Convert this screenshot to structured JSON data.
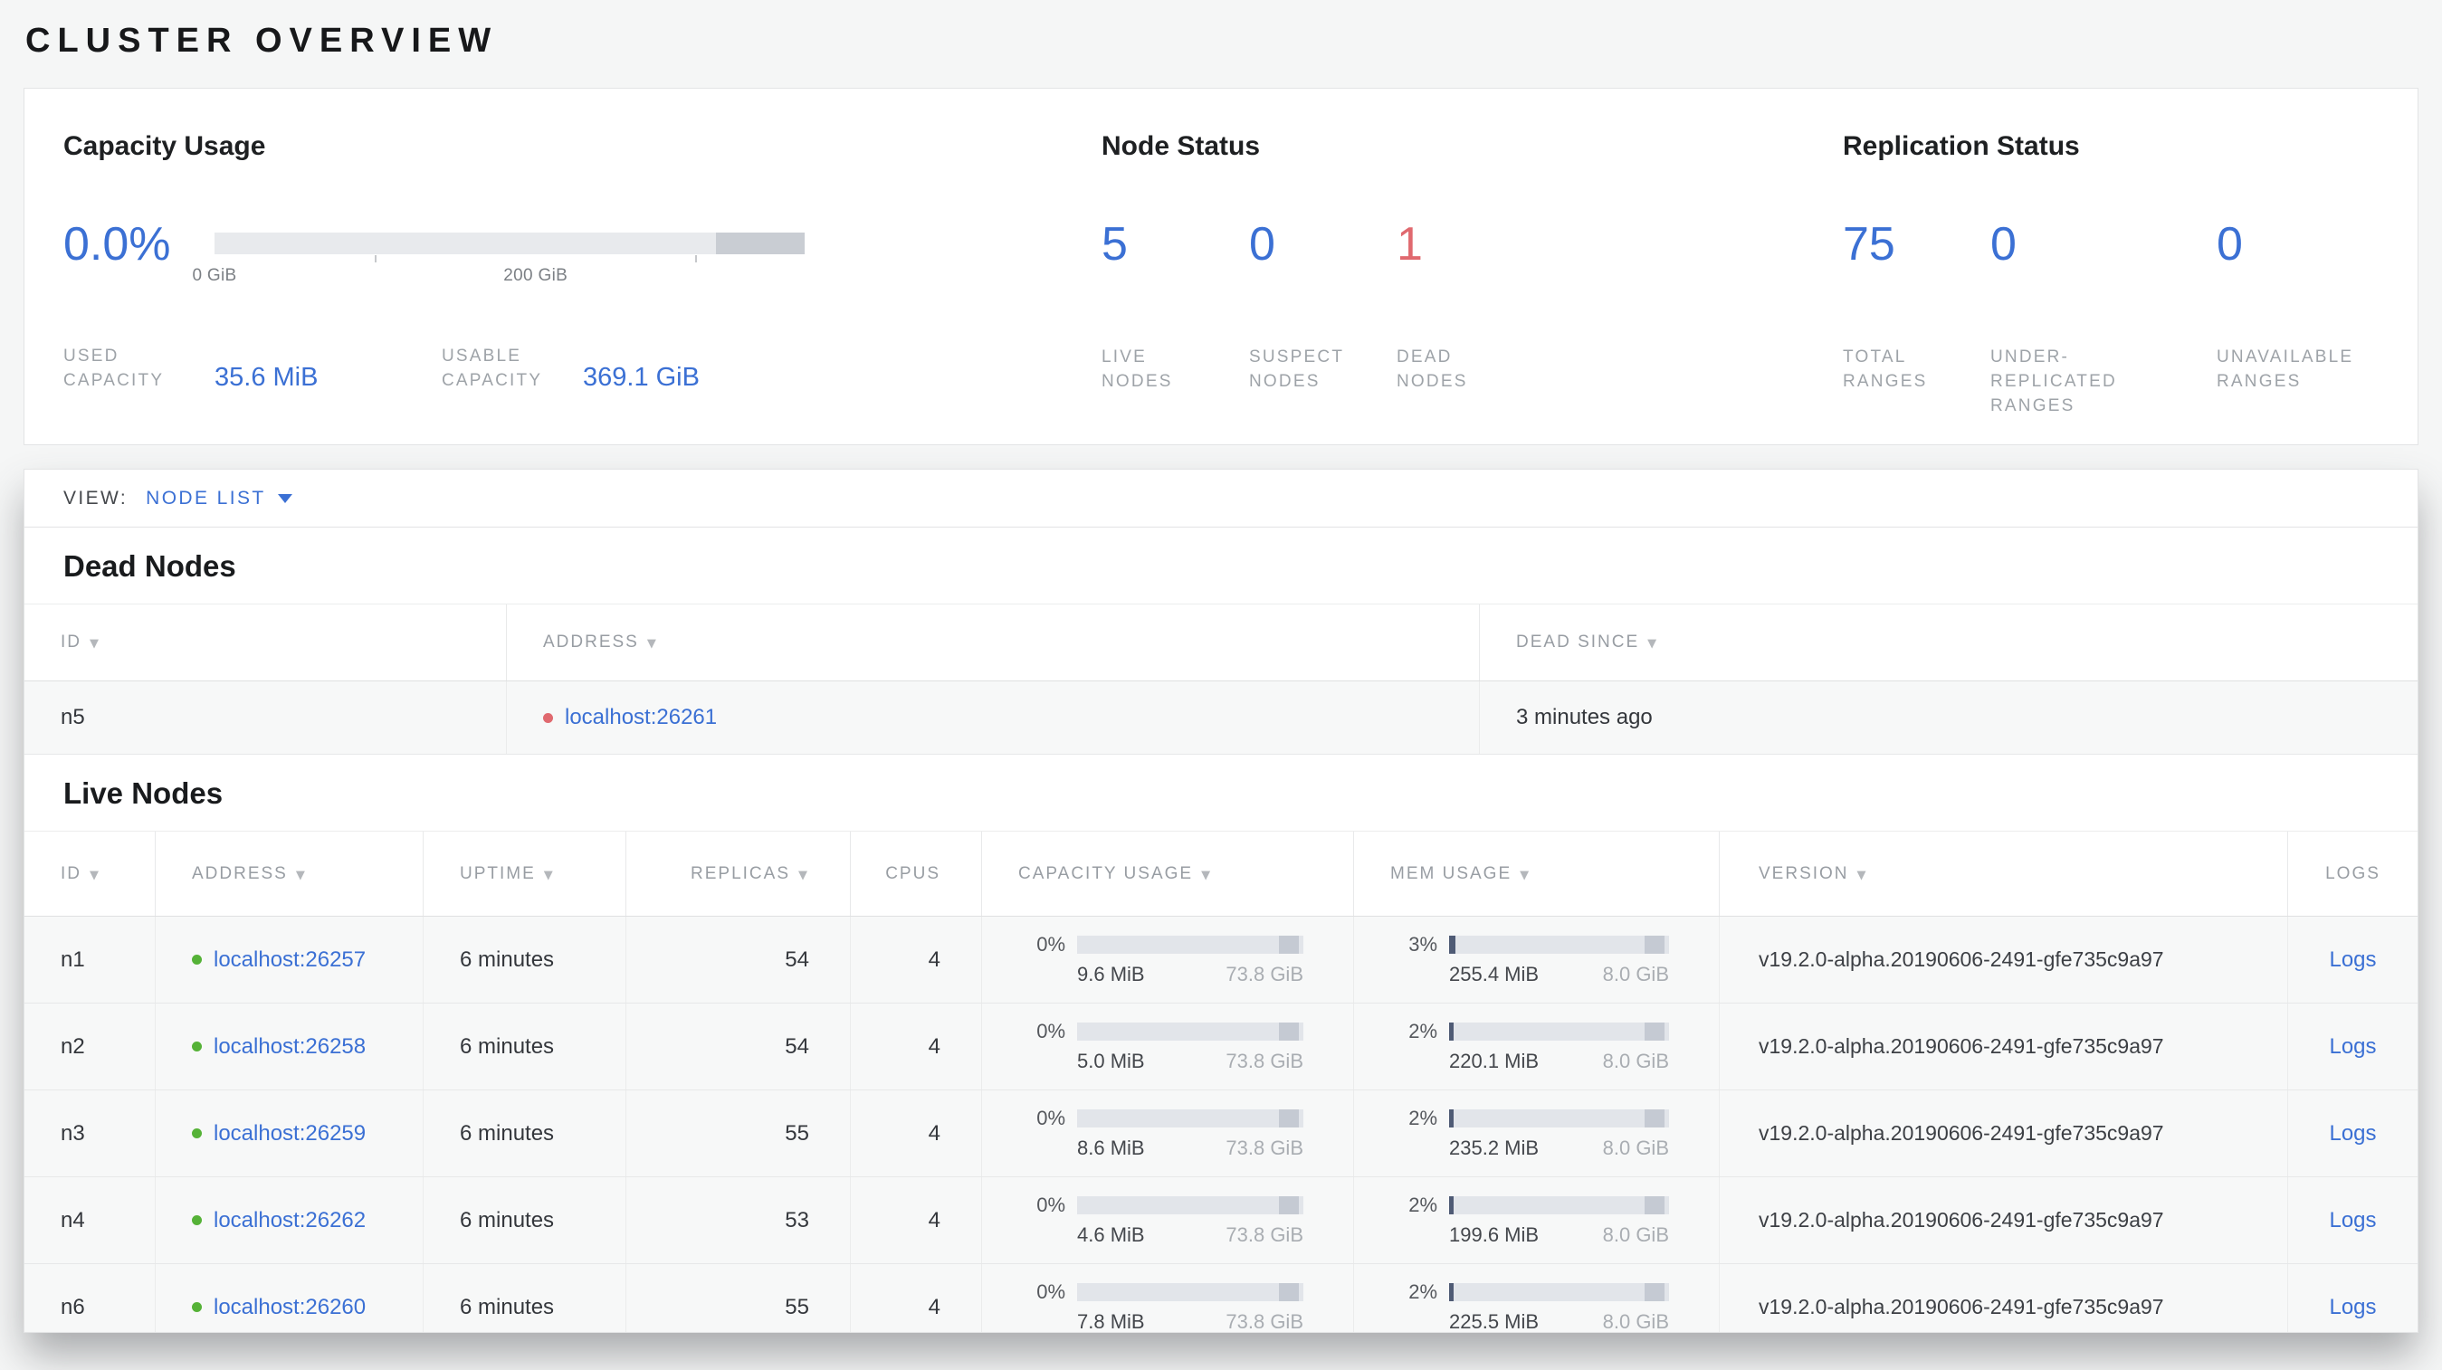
{
  "accent": {
    "blue": "#3b70d4",
    "red": "#e0696f",
    "green": "#55b237"
  },
  "page": {
    "title": "CLUSTER OVERVIEW"
  },
  "summary": {
    "capacity": {
      "title": "Capacity Usage",
      "percent": "0.0%",
      "axis_start": "0 GiB",
      "axis_mid": "200 GiB",
      "used": {
        "label": "USED CAPACITY",
        "value": "35.6 MiB"
      },
      "usable": {
        "label": "USABLE CAPACITY",
        "value": "369.1 GiB"
      }
    },
    "nodes": {
      "title": "Node Status",
      "stats": [
        {
          "value": "5",
          "label": "LIVE NODES"
        },
        {
          "value": "0",
          "label": "SUSPECT NODES"
        },
        {
          "value": "1",
          "label": "DEAD NODES"
        }
      ]
    },
    "replication": {
      "title": "Replication Status",
      "stats": [
        {
          "value": "75",
          "label": "TOTAL RANGES"
        },
        {
          "value": "0",
          "label": "UNDER-REPLICATED RANGES"
        },
        {
          "value": "0",
          "label": "UNAVAILABLE RANGES"
        }
      ]
    }
  },
  "view_bar": {
    "label": "VIEW:",
    "selected": "NODE LIST"
  },
  "dead_nodes": {
    "title": "Dead Nodes",
    "columns": [
      "ID",
      "ADDRESS",
      "DEAD SINCE"
    ],
    "rows": [
      {
        "id": "n5",
        "address": "localhost:26261",
        "dead_since": "3 minutes ago"
      }
    ]
  },
  "live_nodes": {
    "title": "Live Nodes",
    "columns": [
      "ID",
      "ADDRESS",
      "UPTIME",
      "REPLICAS",
      "CPUS",
      "CAPACITY USAGE",
      "MEM USAGE",
      "VERSION",
      "LOGS"
    ],
    "logs_label": "Logs",
    "rows": [
      {
        "id": "n1",
        "address": "localhost:26257",
        "uptime": "6 minutes",
        "replicas": "54",
        "cpus": "4",
        "capacity": {
          "percent": "0%",
          "used": "9.6 MiB",
          "total": "73.8 GiB"
        },
        "mem": {
          "percent": "3%",
          "used": "255.4 MiB",
          "total": "8.0 GiB"
        },
        "version": "v19.2.0-alpha.20190606-2491-gfe735c9a97"
      },
      {
        "id": "n2",
        "address": "localhost:26258",
        "uptime": "6 minutes",
        "replicas": "54",
        "cpus": "4",
        "capacity": {
          "percent": "0%",
          "used": "5.0 MiB",
          "total": "73.8 GiB"
        },
        "mem": {
          "percent": "2%",
          "used": "220.1 MiB",
          "total": "8.0 GiB"
        },
        "version": "v19.2.0-alpha.20190606-2491-gfe735c9a97"
      },
      {
        "id": "n3",
        "address": "localhost:26259",
        "uptime": "6 minutes",
        "replicas": "55",
        "cpus": "4",
        "capacity": {
          "percent": "0%",
          "used": "8.6 MiB",
          "total": "73.8 GiB"
        },
        "mem": {
          "percent": "2%",
          "used": "235.2 MiB",
          "total": "8.0 GiB"
        },
        "version": "v19.2.0-alpha.20190606-2491-gfe735c9a97"
      },
      {
        "id": "n4",
        "address": "localhost:26262",
        "uptime": "6 minutes",
        "replicas": "53",
        "cpus": "4",
        "capacity": {
          "percent": "0%",
          "used": "4.6 MiB",
          "total": "73.8 GiB"
        },
        "mem": {
          "percent": "2%",
          "used": "199.6 MiB",
          "total": "8.0 GiB"
        },
        "version": "v19.2.0-alpha.20190606-2491-gfe735c9a97"
      },
      {
        "id": "n6",
        "address": "localhost:26260",
        "uptime": "6 minutes",
        "replicas": "55",
        "cpus": "4",
        "capacity": {
          "percent": "0%",
          "used": "7.8 MiB",
          "total": "73.8 GiB"
        },
        "mem": {
          "percent": "2%",
          "used": "225.5 MiB",
          "total": "8.0 GiB"
        },
        "version": "v19.2.0-alpha.20190606-2491-gfe735c9a97"
      }
    ]
  }
}
